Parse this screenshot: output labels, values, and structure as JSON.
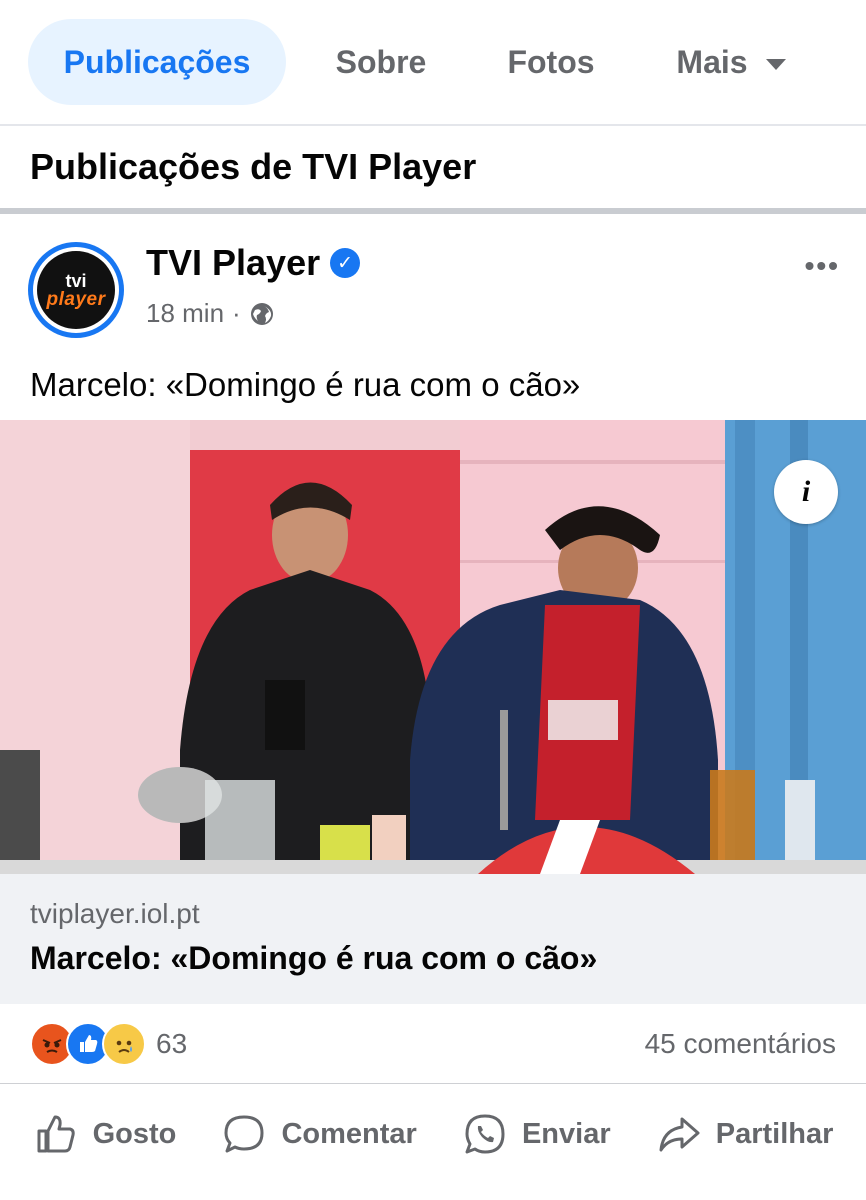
{
  "tabs": [
    {
      "label": "Publicações",
      "active": true
    },
    {
      "label": "Sobre",
      "active": false
    },
    {
      "label": "Fotos",
      "active": false
    },
    {
      "label": "Mais",
      "active": false
    }
  ],
  "section_title": "Publicações de TVI Player",
  "post": {
    "page_name": "TVI Player",
    "avatar_line1": "tvi",
    "avatar_line2": "player",
    "time": "18 min",
    "separator": "·",
    "text": "Marcelo: «Domingo é rua com o cão»",
    "link_domain": "tviplayer.iol.pt",
    "link_title": "Marcelo: «Domingo é rua com o cão»",
    "info_label": "i",
    "reaction_count": "63",
    "comments": "45 comentários"
  },
  "actions": {
    "like": "Gosto",
    "comment": "Comentar",
    "send": "Enviar",
    "share": "Partilhar"
  },
  "colors": {
    "accent": "#1877f2",
    "tab_active_bg": "#e7f3ff",
    "secondary_text": "#65676b",
    "link_box_bg": "#f0f2f5"
  },
  "icons": [
    "verified-badge-icon",
    "globe-icon",
    "more-options-icon",
    "info-icon",
    "like-icon",
    "comment-icon",
    "whatsapp-icon",
    "share-icon"
  ]
}
